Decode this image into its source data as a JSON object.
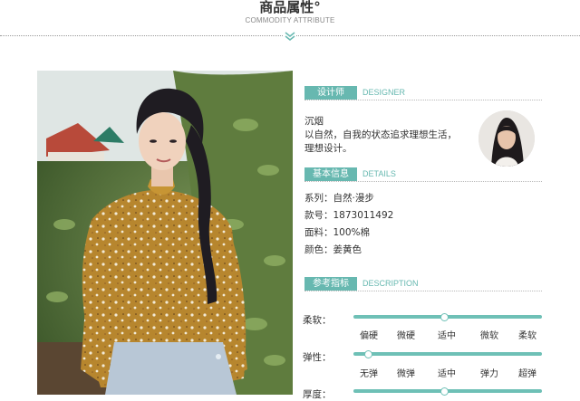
{
  "header": {
    "title": "商品属性°",
    "subtitle": "COMMODITY ATTRIBUTE"
  },
  "designer_section": {
    "tag": "设计师",
    "tag_en": "DESIGNER",
    "name": "沉烟",
    "bio_line1": "以自然，自我的状态追求理想生活，",
    "bio_line2": "理想设计。"
  },
  "details_section": {
    "tag": "基本信息",
    "tag_en": "DETAILS",
    "series": "系列：自然·漫步",
    "item_no": "款号：1873011492",
    "fabric": "面料：100%棉",
    "color": "颜色：姜黄色"
  },
  "description_section": {
    "tag": "参考指标",
    "tag_en": "DESCRIPTION",
    "rows": [
      {
        "label": "柔软：",
        "ticks": [
          "偏硬",
          "微硬",
          "适中",
          "微软",
          "柔软"
        ],
        "selected_index": 2
      },
      {
        "label": "弹性：",
        "ticks": [
          "无弹",
          "微弹",
          "适中",
          "弹力",
          "超弹"
        ],
        "selected_index": 0
      },
      {
        "label": "厚度：",
        "ticks": [],
        "selected_index": 2
      }
    ]
  },
  "colors": {
    "accent": "#67b8b0",
    "track": "#6ec0b6"
  }
}
